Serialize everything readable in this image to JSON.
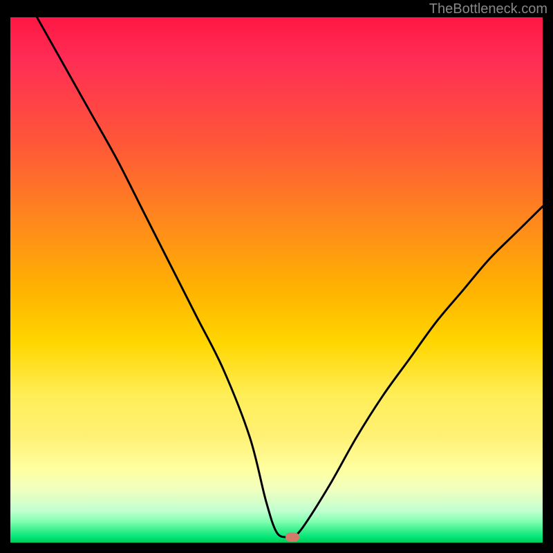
{
  "watermark": "TheBottleneck.com",
  "chart_data": {
    "type": "line",
    "title": "",
    "xlabel": "",
    "ylabel": "",
    "xlim": [
      0,
      100
    ],
    "ylim": [
      0,
      100
    ],
    "series": [
      {
        "name": "bottleneck-curve",
        "x": [
          5,
          10,
          15,
          20,
          25,
          30,
          35,
          40,
          45,
          48,
          50,
          52,
          53,
          55,
          60,
          65,
          70,
          75,
          80,
          85,
          90,
          95,
          100
        ],
        "y": [
          100,
          91,
          82,
          73,
          63,
          53,
          43,
          33,
          20,
          8,
          2,
          1,
          1,
          3,
          11,
          20,
          28,
          35,
          42,
          48,
          54,
          59,
          64
        ]
      }
    ],
    "marker": {
      "x": 53,
      "y": 1,
      "color": "#d47a6a"
    },
    "background_gradient": {
      "top": "#ff1744",
      "bottom": "#00c853",
      "stops": [
        "red",
        "orange",
        "yellow",
        "light-yellow",
        "green"
      ]
    }
  }
}
